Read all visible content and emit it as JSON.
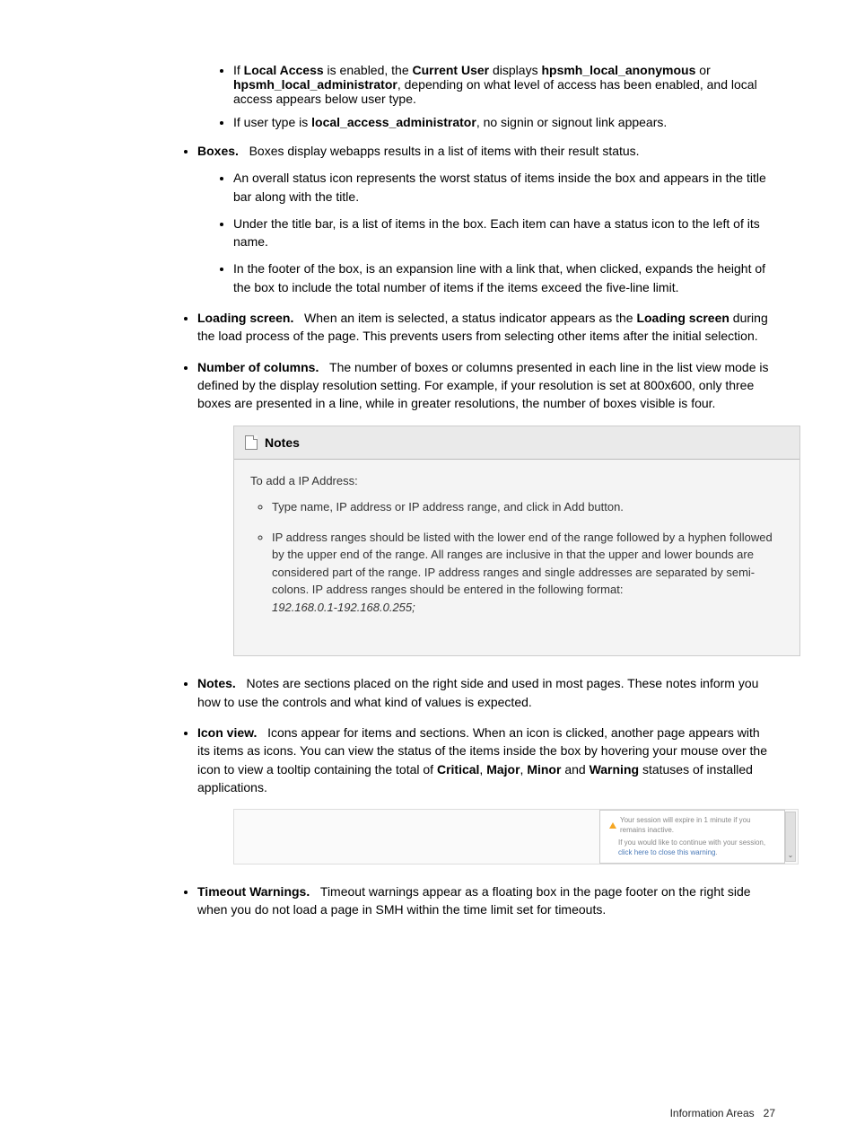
{
  "bullets": {
    "localAccess": {
      "sub1_pre": "If ",
      "sub1_b1": "Local Access",
      "sub1_mid1": " is enabled, the ",
      "sub1_b2": "Current User",
      "sub1_mid2": " displays ",
      "sub1_b3": "hpsmh_local_anonymous",
      "sub1_mid3": " or ",
      "sub1_b4": "hpsmh_local_administrator",
      "sub1_post": ", depending on what level of access has been enabled, and local access appears below user type.",
      "sub2_pre": "If user type is ",
      "sub2_b1": "local_access_administrator",
      "sub2_post": ", no signin or signout link appears."
    },
    "boxes": {
      "label": "Boxes.",
      "text": "Boxes display webapps results in a list of items with their result status.",
      "sub1": "An overall status icon represents the worst status of items inside the box and appears in the title bar along with the title.",
      "sub2": "Under the title bar, is a list of items in the box. Each item can have a status icon to the left of its name.",
      "sub3": "In the footer of the box, is an expansion line with a link that, when clicked, expands the height of the box to include the total number of items if the items exceed the five-line limit."
    },
    "loading": {
      "label": "Loading screen.",
      "text_pre": "When an item is selected, a status indicator appears as the ",
      "text_b": "Loading screen",
      "text_post": " during the load process of the page. This prevents users from selecting other items after the initial selection."
    },
    "columns": {
      "label": "Number of columns.",
      "text": "The number of boxes or columns presented in each line in the list view mode is defined by the display resolution setting. For example, if your resolution is set at 800x600, only three boxes are presented in a line, while in greater resolutions, the number of boxes visible is four."
    },
    "notes": {
      "label": "Notes.",
      "text": "Notes are sections placed on the right side and used in most pages. These notes inform you how to use the controls and what kind of values is expected."
    },
    "iconview": {
      "label": "Icon view.",
      "text_pre": "Icons appear for items and sections. When an icon is clicked, another page appears with its items as icons. You can view the status of the items inside the box by hovering your mouse over the icon to view a tooltip containing the total of ",
      "b1": "Critical",
      "c1": ", ",
      "b2": "Major",
      "c2": ", ",
      "b3": "Minor",
      "c3": " and ",
      "b4": "Warning",
      "text_post": " statuses of installed applications."
    },
    "timeout": {
      "label": "Timeout Warnings.",
      "text": "Timeout warnings appear as a floating box in the page footer on the right side when you do not load a page in SMH within the time limit set for timeouts."
    }
  },
  "figureNotes": {
    "title": "Notes",
    "intro": "To add a IP Address:",
    "item1": "Type name, IP address or IP address range, and click in Add button.",
    "item2": "IP address ranges should be listed with the lower end of the range followed by a hyphen followed by the upper end of the range. All ranges are inclusive in that the upper and lower bounds are considered part of the range. IP address ranges and single addresses are separated by semi-colons. IP address ranges should be entered in the following format:",
    "item2_example": "192.168.0.1-192.168.0.255;"
  },
  "figureTimeout": {
    "line1": "Your session will expire in 1 minute if you remains inactive.",
    "line2_pre": "If you would like to continue with your session, ",
    "line2_link": "click here to close this warning"
  },
  "footer": {
    "section": "Information Areas",
    "page": "27"
  }
}
